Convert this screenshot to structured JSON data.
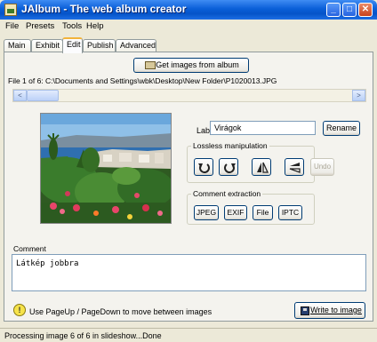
{
  "window": {
    "title": "JAlbum - The web album creator",
    "buttons": {
      "minimize": "_",
      "maximize": "□",
      "close": "✕"
    }
  },
  "menu": [
    "File",
    "Presets",
    "Tools",
    "Help"
  ],
  "tabs": [
    "Main",
    "Exhibit",
    "Edit",
    "Publish",
    "Advanced"
  ],
  "active_tab": "Edit",
  "edit": {
    "get_images_label": "Get images from album",
    "file_info": "File 1 of 6: C:\\Documents and Settings\\wbk\\Desktop\\New Folder\\P1020013.JPG",
    "scroll_left": "<",
    "scroll_right": ">",
    "label_caption": "Label",
    "label_value": "Virágok",
    "rename_label": "Rename",
    "lossless_title": "Lossless manipulation",
    "undo_label": "Undo",
    "comment_extraction_title": "Comment extraction",
    "extraction_buttons": [
      "JPEG",
      "EXIF",
      "File",
      "IPTC"
    ],
    "comment_caption": "Comment",
    "comment_text": "Látkép jobbra",
    "hint_text": "Use PageUp / PageDown to move between images",
    "write_label": "Write to image"
  },
  "status": "Processing image 6 of 6 in slideshow...Done",
  "colors": {
    "title_bar": "#0a5fd8",
    "tab_accent": "#f2b33a",
    "button_border": "#003c74"
  }
}
